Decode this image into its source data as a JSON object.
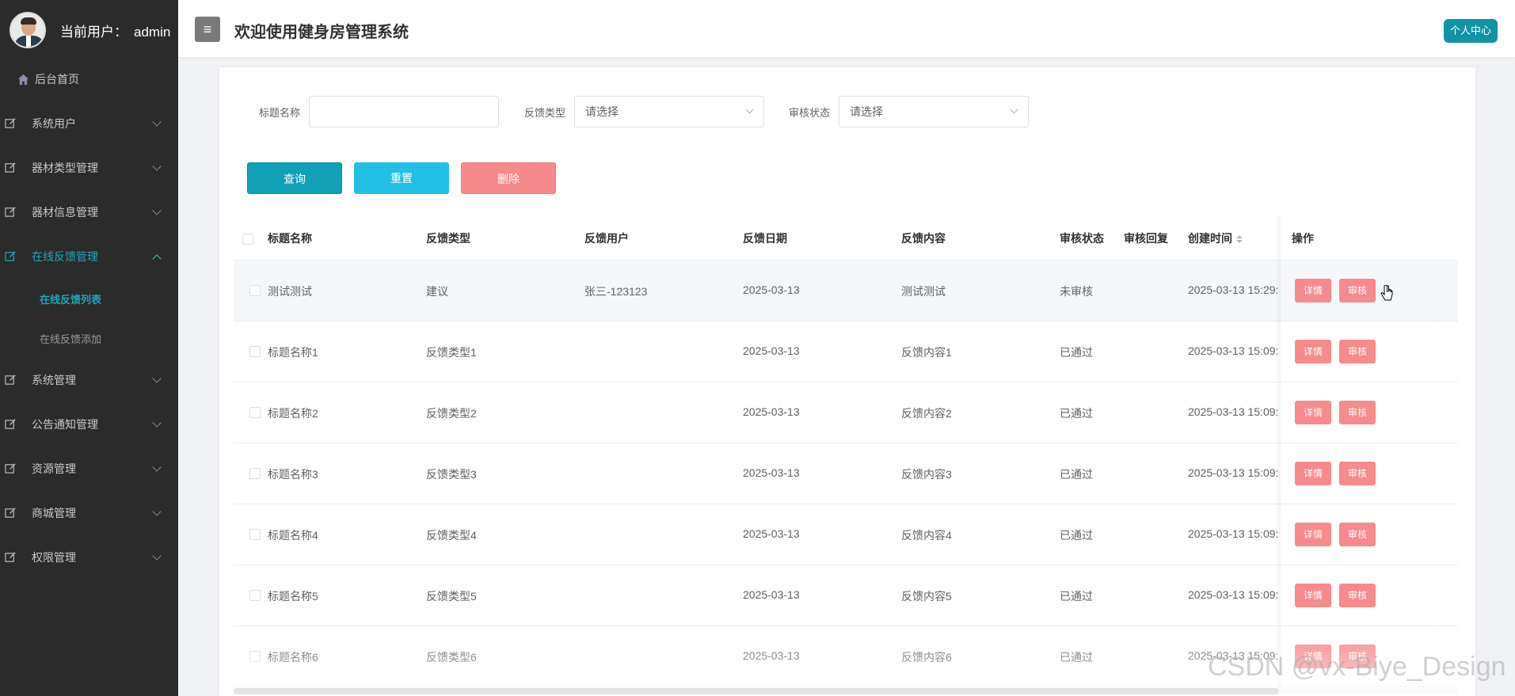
{
  "app": {
    "title": "欢迎使用健身房管理系统",
    "profile_button": "个人中心",
    "hamburger_glyph": "≡"
  },
  "user": {
    "label": "当前用户：",
    "name": "admin"
  },
  "sidebar": {
    "home": "后台首页",
    "items": [
      {
        "label": "系统用户"
      },
      {
        "label": "器材类型管理"
      },
      {
        "label": "器材信息管理"
      },
      {
        "label": "在线反馈管理"
      },
      {
        "label": "系统管理"
      },
      {
        "label": "公告通知管理"
      },
      {
        "label": "资源管理"
      },
      {
        "label": "商城管理"
      },
      {
        "label": "权限管理"
      }
    ],
    "subitems": [
      {
        "label": "在线反馈列表"
      },
      {
        "label": "在线反馈添加"
      }
    ]
  },
  "filters": {
    "title_label": "标题名称",
    "title_value": "",
    "type_label": "反馈类型",
    "type_placeholder": "请选择",
    "status_label": "审核状态",
    "status_placeholder": "请选择"
  },
  "actions": {
    "query": "查询",
    "reset": "重置",
    "delete": "删除"
  },
  "table": {
    "headers": [
      "标题名称",
      "反馈类型",
      "反馈用户",
      "反馈日期",
      "反馈内容",
      "审核状态",
      "审核回复",
      "创建时间",
      "操作"
    ],
    "detail_label": "详情",
    "review_label": "审核",
    "rows": [
      {
        "title": "测试测试",
        "type": "建议",
        "user": "张三-123123",
        "date": "2025-03-13",
        "content": "测试测试",
        "status": "未审核",
        "reply": "",
        "created": "2025-03-13 15:29:"
      },
      {
        "title": "标题名称1",
        "type": "反馈类型1",
        "user": "",
        "date": "2025-03-13",
        "content": "反馈内容1",
        "status": "已通过",
        "reply": "",
        "created": "2025-03-13 15:09:"
      },
      {
        "title": "标题名称2",
        "type": "反馈类型2",
        "user": "",
        "date": "2025-03-13",
        "content": "反馈内容2",
        "status": "已通过",
        "reply": "",
        "created": "2025-03-13 15:09:"
      },
      {
        "title": "标题名称3",
        "type": "反馈类型3",
        "user": "",
        "date": "2025-03-13",
        "content": "反馈内容3",
        "status": "已通过",
        "reply": "",
        "created": "2025-03-13 15:09:"
      },
      {
        "title": "标题名称4",
        "type": "反馈类型4",
        "user": "",
        "date": "2025-03-13",
        "content": "反馈内容4",
        "status": "已通过",
        "reply": "",
        "created": "2025-03-13 15:09:"
      },
      {
        "title": "标题名称5",
        "type": "反馈类型5",
        "user": "",
        "date": "2025-03-13",
        "content": "反馈内容5",
        "status": "已通过",
        "reply": "",
        "created": "2025-03-13 15:09:"
      },
      {
        "title": "标题名称6",
        "type": "反馈类型6",
        "user": "",
        "date": "2025-03-13",
        "content": "反馈内容6",
        "status": "已通过",
        "reply": "",
        "created": "2025-03-13 15:09:"
      }
    ]
  },
  "watermark": "CSDN @vx-Biye_Design",
  "colors": {
    "accent": "#11a0b6",
    "reset": "#22c0e4",
    "danger": "#f78a8c",
    "sidebar_bg": "#2b2b2b",
    "active_menu": "#20a6b8"
  }
}
